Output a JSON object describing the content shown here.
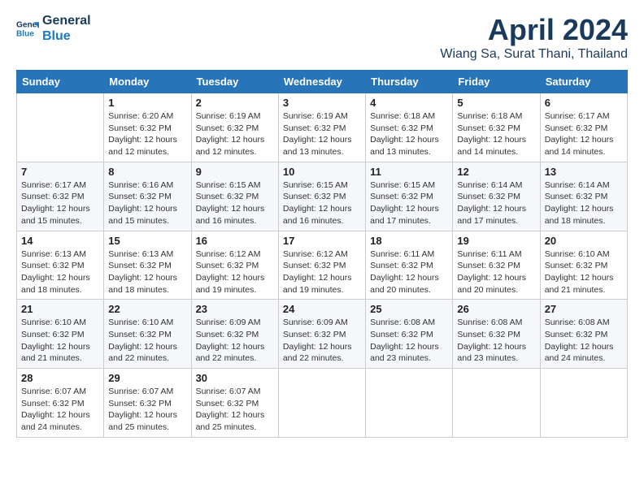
{
  "header": {
    "logo_line1": "General",
    "logo_line2": "Blue",
    "month": "April 2024",
    "location": "Wiang Sa, Surat Thani, Thailand"
  },
  "weekdays": [
    "Sunday",
    "Monday",
    "Tuesday",
    "Wednesday",
    "Thursday",
    "Friday",
    "Saturday"
  ],
  "weeks": [
    [
      {
        "day": "",
        "sunrise": "",
        "sunset": "",
        "daylight": ""
      },
      {
        "day": "1",
        "sunrise": "6:20 AM",
        "sunset": "6:32 PM",
        "daylight": "12 hours and 12 minutes."
      },
      {
        "day": "2",
        "sunrise": "6:19 AM",
        "sunset": "6:32 PM",
        "daylight": "12 hours and 12 minutes."
      },
      {
        "day": "3",
        "sunrise": "6:19 AM",
        "sunset": "6:32 PM",
        "daylight": "12 hours and 13 minutes."
      },
      {
        "day": "4",
        "sunrise": "6:18 AM",
        "sunset": "6:32 PM",
        "daylight": "12 hours and 13 minutes."
      },
      {
        "day": "5",
        "sunrise": "6:18 AM",
        "sunset": "6:32 PM",
        "daylight": "12 hours and 14 minutes."
      },
      {
        "day": "6",
        "sunrise": "6:17 AM",
        "sunset": "6:32 PM",
        "daylight": "12 hours and 14 minutes."
      }
    ],
    [
      {
        "day": "7",
        "sunrise": "6:17 AM",
        "sunset": "6:32 PM",
        "daylight": "12 hours and 15 minutes."
      },
      {
        "day": "8",
        "sunrise": "6:16 AM",
        "sunset": "6:32 PM",
        "daylight": "12 hours and 15 minutes."
      },
      {
        "day": "9",
        "sunrise": "6:15 AM",
        "sunset": "6:32 PM",
        "daylight": "12 hours and 16 minutes."
      },
      {
        "day": "10",
        "sunrise": "6:15 AM",
        "sunset": "6:32 PM",
        "daylight": "12 hours and 16 minutes."
      },
      {
        "day": "11",
        "sunrise": "6:15 AM",
        "sunset": "6:32 PM",
        "daylight": "12 hours and 17 minutes."
      },
      {
        "day": "12",
        "sunrise": "6:14 AM",
        "sunset": "6:32 PM",
        "daylight": "12 hours and 17 minutes."
      },
      {
        "day": "13",
        "sunrise": "6:14 AM",
        "sunset": "6:32 PM",
        "daylight": "12 hours and 18 minutes."
      }
    ],
    [
      {
        "day": "14",
        "sunrise": "6:13 AM",
        "sunset": "6:32 PM",
        "daylight": "12 hours and 18 minutes."
      },
      {
        "day": "15",
        "sunrise": "6:13 AM",
        "sunset": "6:32 PM",
        "daylight": "12 hours and 18 minutes."
      },
      {
        "day": "16",
        "sunrise": "6:12 AM",
        "sunset": "6:32 PM",
        "daylight": "12 hours and 19 minutes."
      },
      {
        "day": "17",
        "sunrise": "6:12 AM",
        "sunset": "6:32 PM",
        "daylight": "12 hours and 19 minutes."
      },
      {
        "day": "18",
        "sunrise": "6:11 AM",
        "sunset": "6:32 PM",
        "daylight": "12 hours and 20 minutes."
      },
      {
        "day": "19",
        "sunrise": "6:11 AM",
        "sunset": "6:32 PM",
        "daylight": "12 hours and 20 minutes."
      },
      {
        "day": "20",
        "sunrise": "6:10 AM",
        "sunset": "6:32 PM",
        "daylight": "12 hours and 21 minutes."
      }
    ],
    [
      {
        "day": "21",
        "sunrise": "6:10 AM",
        "sunset": "6:32 PM",
        "daylight": "12 hours and 21 minutes."
      },
      {
        "day": "22",
        "sunrise": "6:10 AM",
        "sunset": "6:32 PM",
        "daylight": "12 hours and 22 minutes."
      },
      {
        "day": "23",
        "sunrise": "6:09 AM",
        "sunset": "6:32 PM",
        "daylight": "12 hours and 22 minutes."
      },
      {
        "day": "24",
        "sunrise": "6:09 AM",
        "sunset": "6:32 PM",
        "daylight": "12 hours and 22 minutes."
      },
      {
        "day": "25",
        "sunrise": "6:08 AM",
        "sunset": "6:32 PM",
        "daylight": "12 hours and 23 minutes."
      },
      {
        "day": "26",
        "sunrise": "6:08 AM",
        "sunset": "6:32 PM",
        "daylight": "12 hours and 23 minutes."
      },
      {
        "day": "27",
        "sunrise": "6:08 AM",
        "sunset": "6:32 PM",
        "daylight": "12 hours and 24 minutes."
      }
    ],
    [
      {
        "day": "28",
        "sunrise": "6:07 AM",
        "sunset": "6:32 PM",
        "daylight": "12 hours and 24 minutes."
      },
      {
        "day": "29",
        "sunrise": "6:07 AM",
        "sunset": "6:32 PM",
        "daylight": "12 hours and 25 minutes."
      },
      {
        "day": "30",
        "sunrise": "6:07 AM",
        "sunset": "6:32 PM",
        "daylight": "12 hours and 25 minutes."
      },
      {
        "day": "",
        "sunrise": "",
        "sunset": "",
        "daylight": ""
      },
      {
        "day": "",
        "sunrise": "",
        "sunset": "",
        "daylight": ""
      },
      {
        "day": "",
        "sunrise": "",
        "sunset": "",
        "daylight": ""
      },
      {
        "day": "",
        "sunrise": "",
        "sunset": "",
        "daylight": ""
      }
    ]
  ],
  "labels": {
    "sunrise_prefix": "Sunrise: ",
    "sunset_prefix": "Sunset: ",
    "daylight_prefix": "Daylight: "
  }
}
